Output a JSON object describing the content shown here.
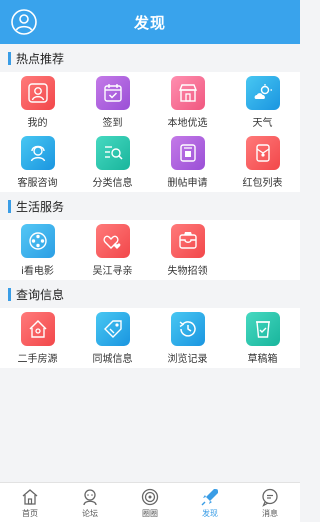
{
  "header": {
    "title": "发现"
  },
  "sections": [
    {
      "title": "热点推荐",
      "items": [
        {
          "label": "我的",
          "icon": "person-icon"
        },
        {
          "label": "签到",
          "icon": "calendar-check-icon"
        },
        {
          "label": "本地优选",
          "icon": "shop-icon"
        },
        {
          "label": "天气",
          "icon": "weather-icon"
        },
        {
          "label": "客服咨询",
          "icon": "customer-service-icon"
        },
        {
          "label": "分类信息",
          "icon": "search-list-icon"
        },
        {
          "label": "删帖申请",
          "icon": "delete-post-icon"
        },
        {
          "label": "红包列表",
          "icon": "red-envelope-icon"
        }
      ]
    },
    {
      "title": "生活服务",
      "items": [
        {
          "label": "i看电影",
          "icon": "film-reel-icon"
        },
        {
          "label": "吴江寻亲",
          "icon": "hearts-icon"
        },
        {
          "label": "失物招领",
          "icon": "lost-found-icon"
        }
      ]
    },
    {
      "title": "查询信息",
      "items": [
        {
          "label": "二手房源",
          "icon": "house-icon"
        },
        {
          "label": "同城信息",
          "icon": "tag-icon"
        },
        {
          "label": "浏览记录",
          "icon": "history-icon"
        },
        {
          "label": "草稿箱",
          "icon": "drafts-icon"
        }
      ]
    }
  ],
  "tabbar": [
    {
      "label": "首页",
      "icon": "home-icon",
      "active": false
    },
    {
      "label": "论坛",
      "icon": "forum-icon",
      "active": false
    },
    {
      "label": "圈圈",
      "icon": "circle-icon",
      "active": false
    },
    {
      "label": "发现",
      "icon": "rocket-icon",
      "active": true
    },
    {
      "label": "消息",
      "icon": "message-icon",
      "active": false
    }
  ],
  "colors": {
    "header": "#39a3ec",
    "accent": "#3a9de6",
    "active_tab": "#3a9de6"
  }
}
